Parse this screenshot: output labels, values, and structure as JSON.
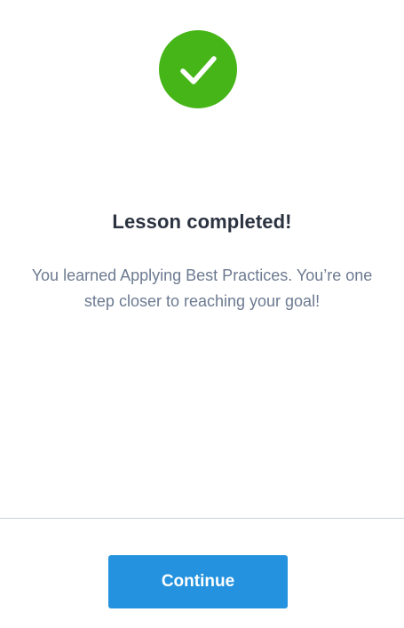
{
  "completion": {
    "icon": "checkmark-icon",
    "badge_color": "#46b517",
    "title": "Lesson completed!",
    "message": "You learned Applying Best Practices. You’re one step closer to reaching your goal!"
  },
  "footer": {
    "continue_label": "Continue",
    "button_color": "#2492df"
  }
}
